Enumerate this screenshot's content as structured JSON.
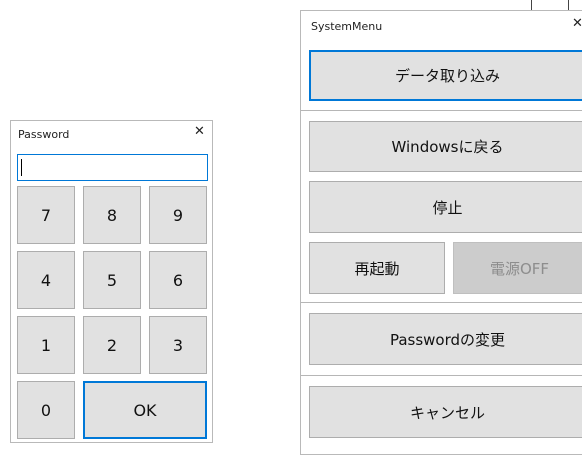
{
  "password_dialog": {
    "title": "Password",
    "close_glyph": "✕",
    "input_value": "",
    "keys": {
      "k7": "7",
      "k8": "8",
      "k9": "9",
      "k4": "4",
      "k5": "5",
      "k6": "6",
      "k1": "1",
      "k2": "2",
      "k3": "3",
      "k0": "0",
      "ok": "OK"
    }
  },
  "system_menu": {
    "title": "SystemMenu",
    "close_glyph": "✕",
    "buttons": {
      "data_import": "データ取り込み",
      "return_windows": "Windowsに戻る",
      "stop": "停止",
      "restart": "再起動",
      "power_off": "電源OFF",
      "change_password": "Passwordの変更",
      "cancel": "キャンセル"
    }
  },
  "colors": {
    "focus_border": "#0078d7",
    "button_face": "#e1e1e1",
    "disabled_face": "#cccccc",
    "disabled_text": "#8d8d8d"
  }
}
